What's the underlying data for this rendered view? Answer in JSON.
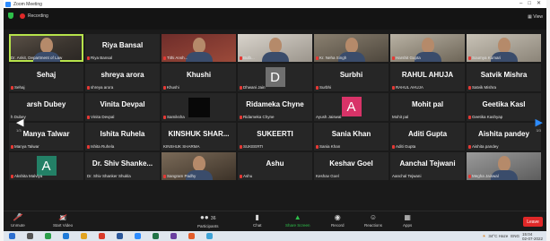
{
  "window": {
    "title": "Zoom Meeting",
    "controls": [
      "–",
      "□",
      "✕"
    ]
  },
  "top_bar": {
    "recording_label": "Recording",
    "view_label": "View"
  },
  "tiles": [
    {
      "kind": "video",
      "style": "video active",
      "name": "",
      "label": "Dr. Ankit, Department of Law",
      "muted": false
    },
    {
      "kind": "name",
      "style": "",
      "name": "Riya Bansal",
      "label": "Riya Bansal",
      "muted": true
    },
    {
      "kind": "video",
      "style": "video v3",
      "name": "",
      "label": "Tithi Ansh...",
      "muted": true
    },
    {
      "kind": "video",
      "style": "video v4",
      "name": "",
      "label": "Bulb...",
      "muted": true
    },
    {
      "kind": "video",
      "style": "video v5",
      "name": "",
      "label": "Kr. Neha Singh",
      "muted": true
    },
    {
      "kind": "video",
      "style": "video v6",
      "name": "",
      "label": "Harshit Gupta",
      "muted": true
    },
    {
      "kind": "video",
      "style": "video v2",
      "name": "",
      "label": "Soumya Kumari",
      "muted": true
    },
    {
      "kind": "name",
      "style": "",
      "name": "Sehaj",
      "label": "Sehaj",
      "muted": true
    },
    {
      "kind": "name",
      "style": "",
      "name": "shreya arora",
      "label": "shreya arora",
      "muted": true
    },
    {
      "kind": "name",
      "style": "",
      "name": "Khushi",
      "label": "Khushi",
      "muted": true
    },
    {
      "kind": "avatar",
      "style": "",
      "avatar_class": "grey",
      "letter": "D",
      "name": "",
      "label": "Dhwani Jain",
      "muted": true
    },
    {
      "kind": "name",
      "style": "",
      "name": "Surbhi",
      "label": "Surbhi",
      "muted": true
    },
    {
      "kind": "name",
      "style": "",
      "name": "RAHUL AHUJA",
      "label": "RAHUL AHUJA",
      "muted": true
    },
    {
      "kind": "name",
      "style": "",
      "name": "Satvik Mishra",
      "label": "Satvik Mishra",
      "muted": true
    },
    {
      "kind": "name",
      "style": "",
      "name": "arsh Dubey",
      "label": "h Dubey",
      "muted": false
    },
    {
      "kind": "name",
      "style": "",
      "name": "Vinita Devpal",
      "label": "Vinita Devpal",
      "muted": true
    },
    {
      "kind": "black",
      "style": "",
      "name": "",
      "label": "Samiksha",
      "muted": true
    },
    {
      "kind": "name",
      "style": "",
      "name": "Ridameka Chyne",
      "label": "Ridameka Chyne",
      "muted": true
    },
    {
      "kind": "avatar",
      "style": "",
      "avatar_class": "pink",
      "letter": "A",
      "name": "",
      "label": "Ayush Jaiswal",
      "muted": false
    },
    {
      "kind": "name",
      "style": "",
      "name": "Mohit pal",
      "label": "Mohit pal",
      "muted": false
    },
    {
      "kind": "name",
      "style": "",
      "name": "Geetika Kasl",
      "label": "Geetika Kashyap",
      "muted": true
    },
    {
      "kind": "name",
      "style": "",
      "name": "Manya Talwar",
      "label": "Manya Talwar",
      "muted": true
    },
    {
      "kind": "name",
      "style": "",
      "name": "Ishita Ruhela",
      "label": "Ishita Ruhela",
      "muted": true
    },
    {
      "kind": "name",
      "style": "",
      "name": "KINSHUK SHAR...",
      "label": "KINSHUK SHARMA",
      "muted": false
    },
    {
      "kind": "name",
      "style": "",
      "name": "SUKEERTI",
      "label": "SUKEERTI",
      "muted": true
    },
    {
      "kind": "name",
      "style": "",
      "name": "Sania Khan",
      "label": "Sania Khan",
      "muted": true
    },
    {
      "kind": "name",
      "style": "",
      "name": "Aditi Gupta",
      "label": "Aditi Gupta",
      "muted": true
    },
    {
      "kind": "name",
      "style": "",
      "name": "Aishita pandey",
      "label": "Aishita pandey",
      "muted": true
    },
    {
      "kind": "avatar",
      "style": "",
      "avatar_class": "teal",
      "letter": "A",
      "name": "",
      "label": "Akshita Malviya",
      "muted": true
    },
    {
      "kind": "name",
      "style": "",
      "name": "Dr. Shiv Shanke...",
      "label": "Dr. Shiv Shanker Shukla",
      "muted": false
    },
    {
      "kind": "video",
      "style": "video v9",
      "name": "",
      "label": "Sangram Padhy",
      "muted": true
    },
    {
      "kind": "name",
      "style": "",
      "name": "Ashu",
      "label": "Ashu",
      "muted": true
    },
    {
      "kind": "name",
      "style": "",
      "name": "Keshav Goel",
      "label": "Keshav Goel",
      "muted": false
    },
    {
      "kind": "name",
      "style": "",
      "name": "Aanchal Tejwani",
      "label": "Aanchal Tejwani",
      "muted": false
    },
    {
      "kind": "video",
      "style": "video v7",
      "name": "",
      "label": "Megha Jaiswal",
      "muted": true
    }
  ],
  "pager": {
    "left": "1/3",
    "right": "3/3"
  },
  "toolbar": {
    "unmute": "Unmute",
    "start_video": "Start Video",
    "participants": "Participants",
    "participant_count": "36",
    "chat": "Chat",
    "share_screen": "Share Screen",
    "record": "Record",
    "reactions": "Reactions",
    "apps": "Apps",
    "leave": "Leave"
  },
  "taskbar": {
    "weather": "34°C Haze",
    "language": "ENG",
    "time": "15:04",
    "date": "02-07-2022"
  },
  "colors": {
    "zoom_blue": "#2d8cff",
    "muted_red": "#e53935",
    "active_speaker": "#b7e34b",
    "share_green": "#2ec04a",
    "leave_red": "#e02828"
  }
}
